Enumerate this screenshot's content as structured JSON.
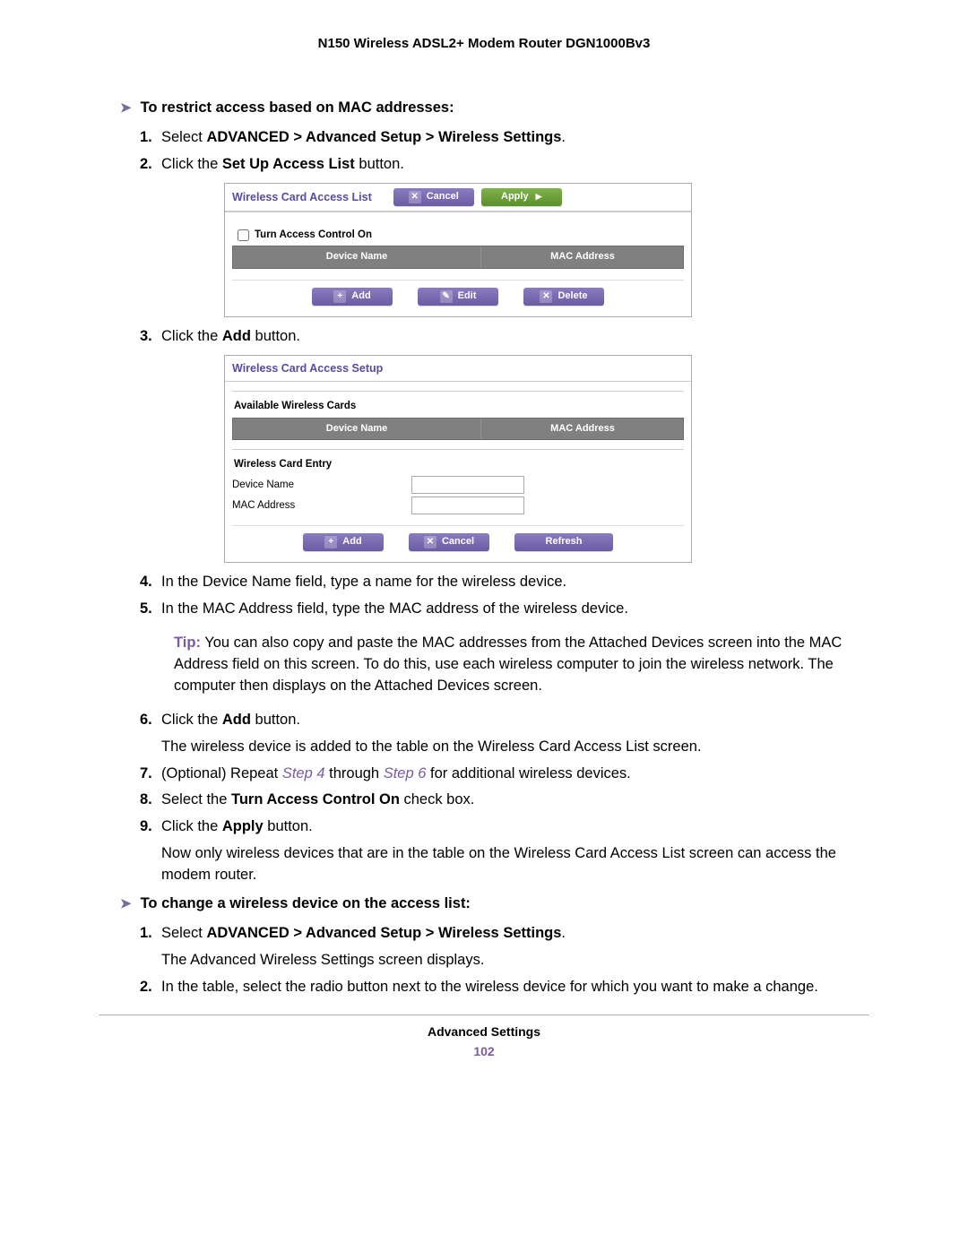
{
  "header": {
    "product": "N150 Wireless ADSL2+ Modem Router DGN1000Bv3"
  },
  "sectionA": {
    "heading": "To restrict access based on MAC addresses:"
  },
  "sectionB": {
    "heading": "To change a wireless device on the access list:"
  },
  "stepsA": {
    "s1_a": "Select ",
    "s1_b": "ADVANCED > Advanced Setup > Wireless Settings",
    "s1_c": ".",
    "s2_a": "Click the ",
    "s2_b": "Set Up Access List",
    "s2_c": " button.",
    "s3_a": "Click the ",
    "s3_b": "Add",
    "s3_c": " button.",
    "s4": "In the Device Name field, type a name for the wireless device.",
    "s5": "In the MAC Address field, type the MAC address of the wireless device.",
    "s6_a": "Click the ",
    "s6_b": "Add",
    "s6_c": " button.",
    "s6_cont": "The wireless device is added to the table on the Wireless Card Access List screen.",
    "s7_a": "(Optional) Repeat ",
    "s7_b": "Step 4",
    "s7_c": " through ",
    "s7_d": "Step 6",
    "s7_e": " for additional wireless devices.",
    "s8_a": "Select the ",
    "s8_b": "Turn Access Control On",
    "s8_c": " check box.",
    "s9_a": "Click the ",
    "s9_b": "Apply",
    "s9_c": " button.",
    "s9_cont": "Now only wireless devices that are in the table on the Wireless Card Access List screen can access the modem router."
  },
  "stepsB": {
    "s1_a": "Select ",
    "s1_b": "ADVANCED > Advanced Setup > Wireless Settings",
    "s1_c": ".",
    "s1_cont": "The Advanced Wireless Settings screen displays.",
    "s2": "In the table, select the radio button next to the wireless device for which you want to make a change."
  },
  "tip": {
    "label": "Tip:",
    "text": " You can also copy and paste the MAC addresses from the Attached Devices screen into the MAC Address field on this screen. To do this, use each wireless computer to join the wireless network. The computer then displays on the Attached Devices screen."
  },
  "panel1": {
    "title": "Wireless Card Access List",
    "btn_cancel": "Cancel",
    "btn_apply": "Apply",
    "checkbox": "Turn Access Control On",
    "col_dev": "Device Name",
    "col_mac": "MAC Address",
    "btn_add": "Add",
    "btn_edit": "Edit",
    "btn_delete": "Delete"
  },
  "panel2": {
    "title": "Wireless Card Access Setup",
    "sub_available": "Available Wireless Cards",
    "col_dev": "Device Name",
    "col_mac": "MAC Address",
    "sub_entry": "Wireless Card Entry",
    "lbl_device": "Device Name",
    "lbl_mac": "MAC Address",
    "btn_add": "Add",
    "btn_cancel": "Cancel",
    "btn_refresh": "Refresh"
  },
  "footer": {
    "section": "Advanced Settings",
    "page": "102"
  }
}
